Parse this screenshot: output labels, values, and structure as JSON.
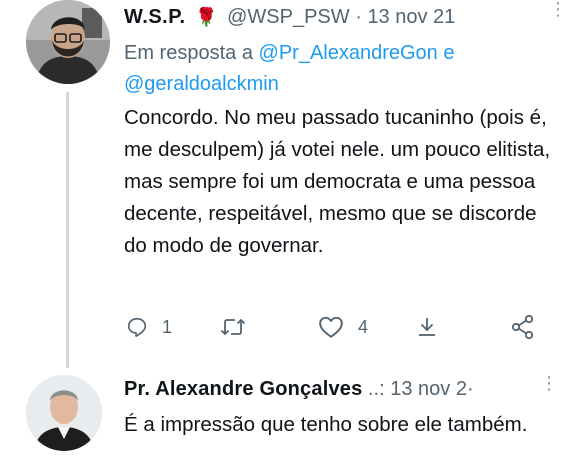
{
  "tweet1": {
    "author_name": "W.S.P.",
    "rose_icon": "rose-emoji",
    "handle": "@WSP_PSW",
    "separator": "·",
    "date": "13 nov 21",
    "reply_prefix": "Em resposta a",
    "mention1": "@Pr_AlexandreGon",
    "conjunction": "e",
    "mention2": "@geraldoalckmin",
    "text": "Concordo. No meu passado tucaninho (pois é, me desculpem) já votei nele. um pouco elitista, mas sempre foi um democrata e uma pessoa decente, respeitável, mesmo que se discorde do modo de governar.",
    "actions": {
      "replies": "1",
      "retweets": "",
      "likes": "4"
    }
  },
  "tweet2": {
    "author_name": "Pr. Alexandre Gonçalves",
    "handle_trunc": "..:",
    "date": "13 nov 2·",
    "text": "É a impressão que tenho sobre ele também."
  },
  "colors": {
    "text": "#0f1419",
    "secondary": "#536471",
    "link": "#1d9bf0",
    "thread_line": "#cfd9de"
  }
}
